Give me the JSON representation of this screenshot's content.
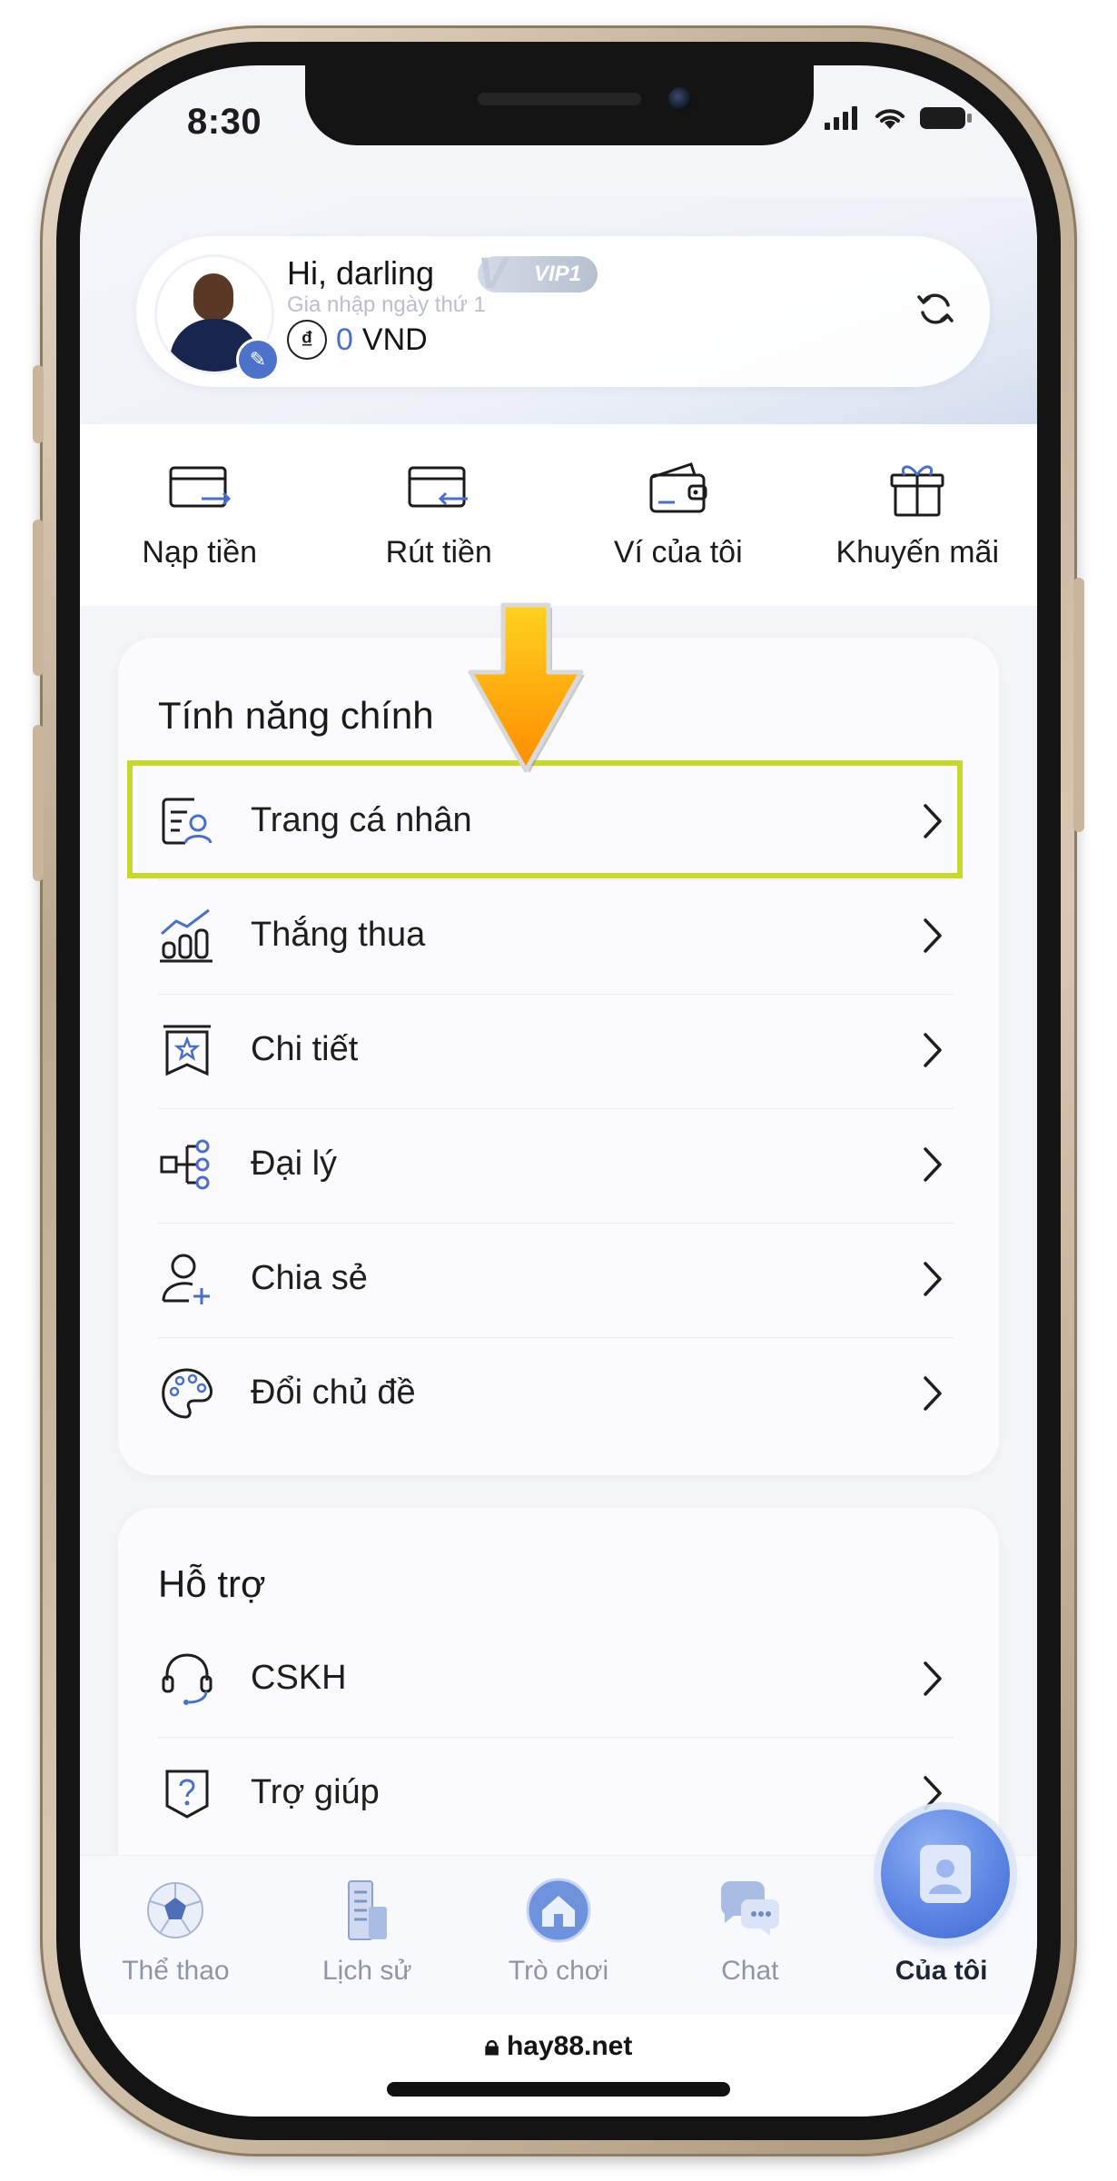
{
  "status_bar": {
    "time": "8:30"
  },
  "profile": {
    "greeting": "Hi, darling",
    "vip_level": "VIP1",
    "joined_text": "Gia nhập ngày thứ 1",
    "currency_symbol": "₫",
    "balance": "0",
    "currency": "VND"
  },
  "quick_actions": [
    {
      "label": "Nạp tiền",
      "icon": "deposit-card-icon"
    },
    {
      "label": "Rút tiền",
      "icon": "withdraw-card-icon"
    },
    {
      "label": "Ví của tôi",
      "icon": "wallet-icon"
    },
    {
      "label": "Khuyến mãi",
      "icon": "gift-icon"
    }
  ],
  "main_features": {
    "title": "Tính năng chính",
    "items": [
      {
        "label": "Trang cá nhân",
        "icon": "profile-card-icon",
        "highlighted": true
      },
      {
        "label": "Thắng thua",
        "icon": "bar-chart-icon"
      },
      {
        "label": "Chi tiết",
        "icon": "star-ticket-icon"
      },
      {
        "label": "Đại lý",
        "icon": "network-tree-icon"
      },
      {
        "label": "Chia sẻ",
        "icon": "user-add-icon"
      },
      {
        "label": "Đổi chủ đề",
        "icon": "palette-icon"
      }
    ]
  },
  "support": {
    "title": "Hỗ trợ",
    "items": [
      {
        "label": "CSKH",
        "icon": "headset-icon"
      },
      {
        "label": "Trợ giúp",
        "icon": "help-shield-icon"
      }
    ]
  },
  "bottom_nav": {
    "active_index": 4,
    "items": [
      {
        "label": "Thể thao",
        "icon": "soccer-ball-icon"
      },
      {
        "label": "Lịch sử",
        "icon": "history-building-icon"
      },
      {
        "label": "Trò chơi",
        "icon": "home-game-icon"
      },
      {
        "label": "Chat",
        "icon": "chat-bubbles-icon"
      },
      {
        "label": "Của tôi",
        "icon": "my-profile-icon"
      }
    ]
  },
  "browser": {
    "url": "hay88.net"
  },
  "colors": {
    "accent_blue": "#4a6fc7",
    "highlight_border": "#c7d92a",
    "arrow_gradient_top": "#ffd21f",
    "arrow_gradient_bottom": "#ff8c00"
  }
}
